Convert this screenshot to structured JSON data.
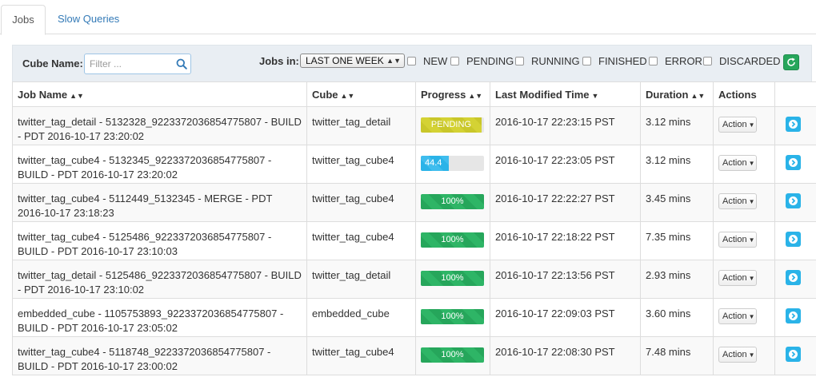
{
  "tabs": [
    {
      "label": "Jobs",
      "active": true
    },
    {
      "label": "Slow Queries",
      "active": false
    }
  ],
  "filter": {
    "cube_name_label": "Cube Name:",
    "search_placeholder": "Filter ...",
    "jobs_in_label": "Jobs in:",
    "jobs_in_value": "LAST ONE WEEK",
    "statuses": [
      "NEW",
      "PENDING",
      "RUNNING",
      "FINISHED",
      "ERROR",
      "DISCARDED"
    ]
  },
  "table": {
    "headers": {
      "job_name": "Job Name",
      "cube": "Cube",
      "progress": "Progress",
      "last_modified": "Last Modified Time",
      "duration": "Duration",
      "actions": "Actions"
    },
    "rows": [
      {
        "job": "twitter_tag_detail - 5132328_9223372036854775807 - BUILD - PDT 2016-10-17 23:20:02",
        "cube": "twitter_tag_detail",
        "progress_label": "PENDING",
        "progress_pct": 96,
        "progress_kind": "warning",
        "modified": "2016-10-17 22:23:15 PST",
        "duration": "3.12 mins",
        "action": "Action"
      },
      {
        "job": "twitter_tag_cube4 - 5132345_9223372036854775807 - BUILD - PDT 2016-10-17 23:20:02",
        "cube": "twitter_tag_cube4",
        "progress_label": "44.4",
        "progress_pct": 44.4,
        "progress_kind": "info",
        "modified": "2016-10-17 22:23:05 PST",
        "duration": "3.12 mins",
        "action": "Action"
      },
      {
        "job": "twitter_tag_cube4 - 5112449_5132345 - MERGE - PDT 2016-10-17 23:18:23",
        "cube": "twitter_tag_cube4",
        "progress_label": "100%",
        "progress_pct": 100,
        "progress_kind": "success",
        "modified": "2016-10-17 22:22:27 PST",
        "duration": "3.45 mins",
        "action": "Action"
      },
      {
        "job": "twitter_tag_cube4 - 5125486_9223372036854775807 - BUILD - PDT 2016-10-17 23:10:03",
        "cube": "twitter_tag_cube4",
        "progress_label": "100%",
        "progress_pct": 100,
        "progress_kind": "success",
        "modified": "2016-10-17 22:18:22 PST",
        "duration": "7.35 mins",
        "action": "Action"
      },
      {
        "job": "twitter_tag_detail - 5125486_9223372036854775807 - BUILD - PDT 2016-10-17 23:10:02",
        "cube": "twitter_tag_detail",
        "progress_label": "100%",
        "progress_pct": 100,
        "progress_kind": "success",
        "modified": "2016-10-17 22:13:56 PST",
        "duration": "2.93 mins",
        "action": "Action"
      },
      {
        "job": "embedded_cube - 1105753893_9223372036854775807 - BUILD - PDT 2016-10-17 23:05:02",
        "cube": "embedded_cube",
        "progress_label": "100%",
        "progress_pct": 100,
        "progress_kind": "success",
        "modified": "2016-10-17 22:09:03 PST",
        "duration": "3.60 mins",
        "action": "Action"
      },
      {
        "job": "twitter_tag_cube4 - 5118748_9223372036854775807 - BUILD - PDT 2016-10-17 23:00:02",
        "cube": "twitter_tag_cube4",
        "progress_label": "100%",
        "progress_pct": 100,
        "progress_kind": "success",
        "modified": "2016-10-17 22:08:30 PST",
        "duration": "7.48 mins",
        "action": "Action"
      }
    ]
  },
  "colors": {
    "success": "#26a65b",
    "info": "#2ab3e8",
    "warning": "#c9c72a",
    "link": "#337ab7"
  },
  "icons": {
    "search": "search-icon",
    "refresh": "refresh-icon",
    "sort": "sort-icon",
    "sort_desc": "sort-desc-icon",
    "go": "arrow-right-circle-icon"
  }
}
